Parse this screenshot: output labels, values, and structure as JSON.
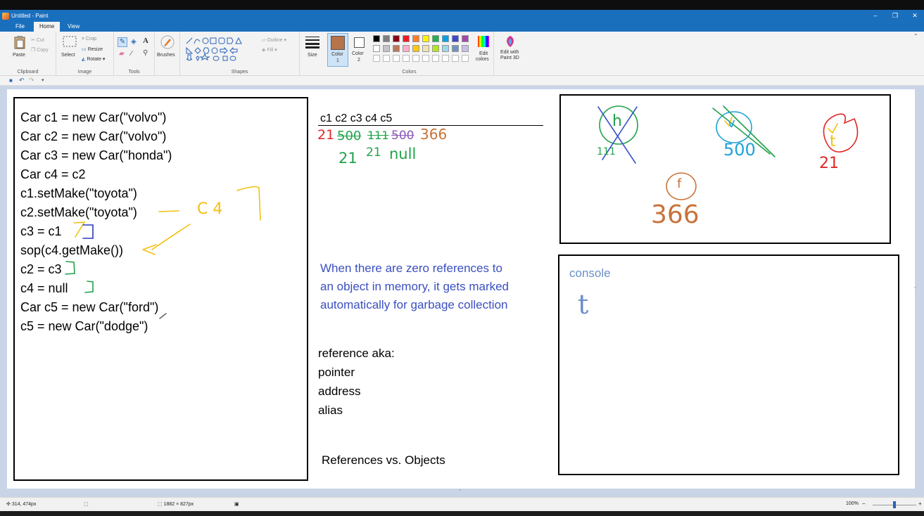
{
  "window": {
    "title": "Untitled - Paint",
    "minimize_glyph": "–",
    "maximize_glyph": "❐",
    "close_glyph": "✕"
  },
  "menu": {
    "file": "File",
    "home": "Home",
    "view": "View"
  },
  "ribbon": {
    "clipboard": {
      "label": "Clipboard",
      "paste": "Paste",
      "cut": "Cut",
      "copy": "Copy"
    },
    "image": {
      "label": "Image",
      "select": "Select",
      "crop": "Crop",
      "resize": "Resize",
      "rotate": "Rotate"
    },
    "tools": {
      "label": "Tools"
    },
    "brushes": {
      "label": "Brushes"
    },
    "shapes": {
      "label": "Shapes",
      "outline": "Outline",
      "fill": "Fill"
    },
    "size": {
      "label": "Size"
    },
    "colors": {
      "label": "Colors",
      "color1_line1": "Color",
      "color1_line2": "1",
      "color2_line1": "Color",
      "color2_line2": "2",
      "edit_line1": "Edit",
      "edit_line2": "colors",
      "paint3d_line1": "Edit with",
      "paint3d_line2": "Paint 3D",
      "color1_value": "#b5744a",
      "color2_value": "#ffffff",
      "palette_row1": [
        "#000000",
        "#7f7f7f",
        "#880015",
        "#ed1c24",
        "#ff7f27",
        "#fff200",
        "#22b14c",
        "#00a2e8",
        "#3f48cc",
        "#a349a4"
      ],
      "palette_row2": [
        "#ffffff",
        "#c3c3c3",
        "#b97a57",
        "#ffaec9",
        "#ffc90e",
        "#efe4b0",
        "#b5e61d",
        "#99d9ea",
        "#7092be",
        "#c8bfe7"
      ]
    }
  },
  "canvas": {
    "code_lines": [
      "Car c1 = new Car(\"volvo\")",
      "Car c2 = new Car(\"volvo\")",
      "Car c3 = new Car(\"honda\")",
      "Car c4 = c2",
      "c1.setMake(\"toyota\")",
      "c2.setMake(\"toyota\")",
      "c3 = c1",
      "sop(c4.getMake())",
      "c2 = c3",
      "c4 = null",
      "Car c5 = new Car(\"ford\")",
      "c5 = new Car(\"dodge\")"
    ],
    "header": "c1  c2  c3  c4  c5",
    "note_blue": [
      "When there are zero references to",
      "an object in memory, it gets marked",
      "automatically for garbage collection"
    ],
    "reference_list": [
      "reference aka:",
      "pointer",
      "address",
      "alias"
    ],
    "caption": "References vs. Objects",
    "console_label": "console",
    "handwriting": {
      "c4_note": "C 4",
      "r1_21": "21",
      "r1_500": "500",
      "r1_111": "111",
      "r1_500b": "500",
      "r1_366": "366",
      "r2_21a": "21",
      "r2_21b": "21",
      "r2_null": "null",
      "obj_h": "h",
      "obj_h_addr": "111",
      "obj_v": "v",
      "obj_v_addr": "500",
      "obj_t": "t",
      "obj_t_addr": "21",
      "obj_f": "f",
      "obj_f_addr": "366",
      "console_out": "t"
    }
  },
  "status": {
    "cursor": "314, 474px",
    "dimensions": "1882 × 827px",
    "zoom": "100%",
    "zoom_minus": "−",
    "zoom_plus": "+"
  }
}
